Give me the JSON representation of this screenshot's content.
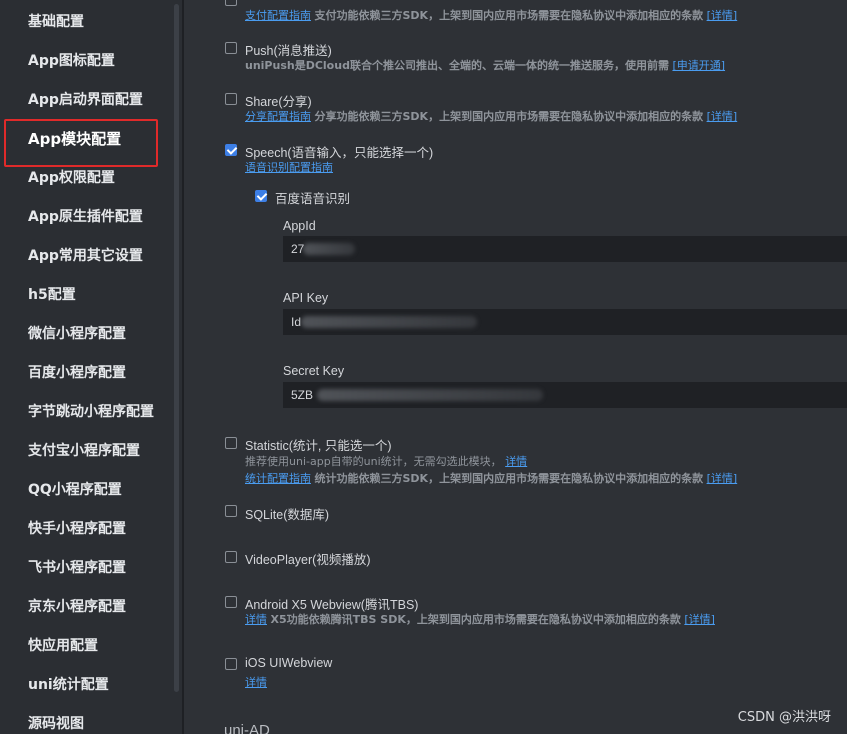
{
  "sidebar": {
    "items": [
      {
        "label": "基础配置"
      },
      {
        "label": "App图标配置"
      },
      {
        "label": "App启动界面配置"
      },
      {
        "label": "App模块配置",
        "active": true
      },
      {
        "label": "App权限配置"
      },
      {
        "label": "App原生插件配置"
      },
      {
        "label": "App常用其它设置"
      },
      {
        "label": "h5配置"
      },
      {
        "label": "微信小程序配置"
      },
      {
        "label": "百度小程序配置"
      },
      {
        "label": "字节跳动小程序配置"
      },
      {
        "label": "支付宝小程序配置"
      },
      {
        "label": "QQ小程序配置"
      },
      {
        "label": "快手小程序配置"
      },
      {
        "label": "飞书小程序配置"
      },
      {
        "label": "京东小程序配置"
      },
      {
        "label": "快应用配置"
      },
      {
        "label": "uni统计配置"
      },
      {
        "label": "源码视图"
      }
    ]
  },
  "main": {
    "payment": {
      "guide_link": "支付配置指南",
      "desc": "支付功能依赖三方SDK，上架到国内应用市场需要在隐私协议中添加相应的条款",
      "detail_link": "[详情]"
    },
    "push": {
      "title": "Push(消息推送)",
      "checked": false,
      "desc": "uniPush是DCloud联合个推公司推出、全端的、云端一体的统一推送服务，使用前需",
      "apply_link": "[申请开通]"
    },
    "share": {
      "title": "Share(分享)",
      "checked": false,
      "guide_link": "分享配置指南",
      "desc": "分享功能依赖三方SDK，上架到国内应用市场需要在隐私协议中添加相应的条款",
      "detail_link": "[详情]"
    },
    "speech": {
      "title": "Speech(语音输入，只能选择一个)",
      "checked": true,
      "guide_link": "语音识别配置指南",
      "baidu": {
        "title": "百度语音识别",
        "checked": true,
        "fields": [
          {
            "label": "AppId",
            "value": "27"
          },
          {
            "label": "API Key",
            "value": "Id"
          },
          {
            "label": "Secret Key",
            "value": "5ZB"
          }
        ]
      }
    },
    "statistic": {
      "title": "Statistic(统计, 只能选一个)",
      "checked": false,
      "line1": "推荐使用uni-app自带的uni统计，无需勾选此模块，",
      "line1_link": "详情",
      "guide_link": "统计配置指南",
      "desc": "统计功能依赖三方SDK，上架到国内应用市场需要在隐私协议中添加相应的条款",
      "detail_link": "[详情]"
    },
    "sqlite": {
      "title": "SQLite(数据库)",
      "checked": false
    },
    "videoplayer": {
      "title": "VideoPlayer(视频播放)",
      "checked": false
    },
    "x5": {
      "title": "Android X5 Webview(腾讯TBS)",
      "checked": false,
      "detail_prefix_link": "详情",
      "desc": "X5功能依赖腾讯TBS SDK，上架到国内应用市场需要在隐私协议中添加相应的条款",
      "detail_link": "[详情]"
    },
    "ios_webview": {
      "title": "iOS UIWebview",
      "checked": false,
      "detail_link": "详情"
    },
    "next_section": "uni-AD"
  },
  "watermark": "CSDN @洪洪呀",
  "colors": {
    "accent": "#3d7fe6",
    "link": "#4a9cf0",
    "highlight_box": "#e02a2a"
  }
}
